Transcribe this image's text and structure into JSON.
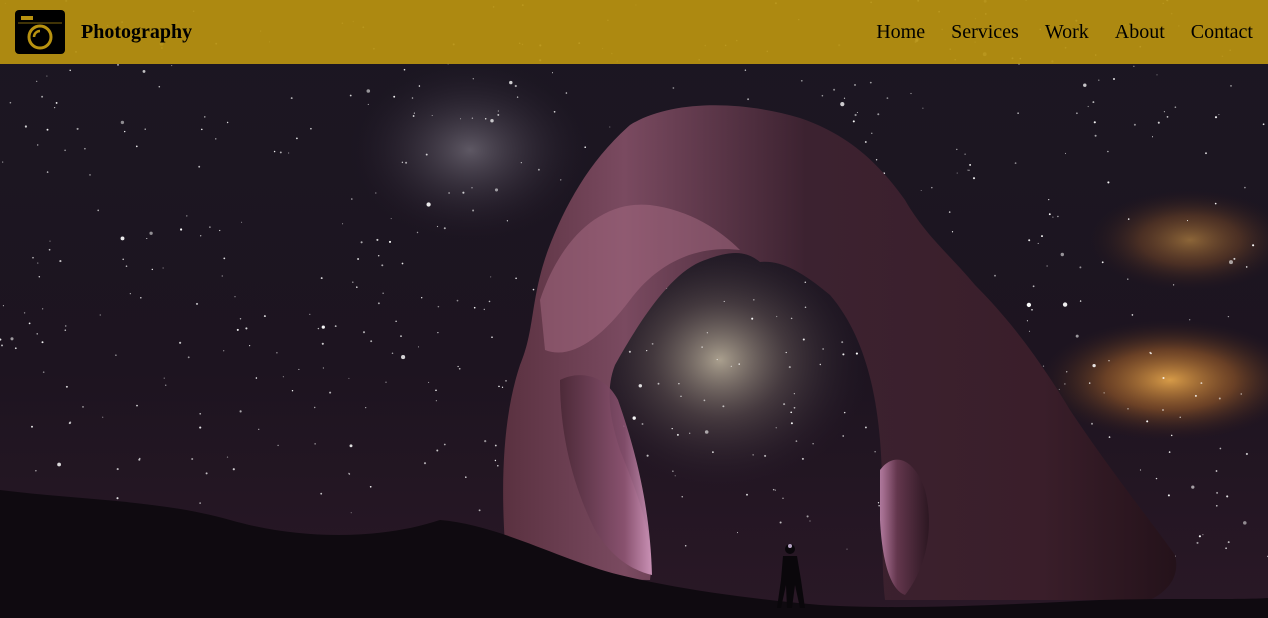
{
  "brand": {
    "name": "Photography",
    "logo_icon": "camera-icon"
  },
  "nav": {
    "items": [
      {
        "label": "Home"
      },
      {
        "label": "Services"
      },
      {
        "label": "Work"
      },
      {
        "label": "About"
      },
      {
        "label": "Contact"
      }
    ]
  },
  "hero": {
    "image": "night-sky-arch-photo"
  },
  "colors": {
    "navbar_background": "#b89210",
    "nav_text": "#000000",
    "sky": "#15111c",
    "rock": "#3a1f2a",
    "rock_glow": "#a86a8e"
  }
}
